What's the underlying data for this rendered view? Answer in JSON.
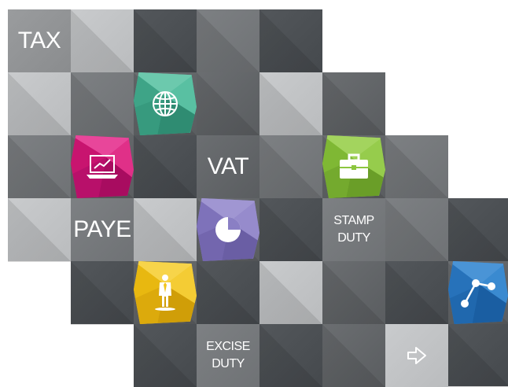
{
  "tiles": {
    "tax": "TAX",
    "vat": "VAT",
    "paye": "PAYE",
    "stamp_duty": "STAMP\nDUTY",
    "excise_duty": "EXCISE\nDUTY"
  },
  "icons": {
    "globe": "globe-icon",
    "laptop": "laptop-chart-icon",
    "briefcase": "briefcase-icon",
    "pie": "pie-chart-icon",
    "businessman": "businessman-icon",
    "network": "network-icon",
    "arrow": "arrow-right-icon"
  },
  "colors": {
    "teal": "#4db89a",
    "magenta": "#d81b7f",
    "green": "#8cc63f",
    "purple": "#8a7fc4",
    "yellow": "#f2c51e",
    "blue": "#2f7fc8"
  }
}
